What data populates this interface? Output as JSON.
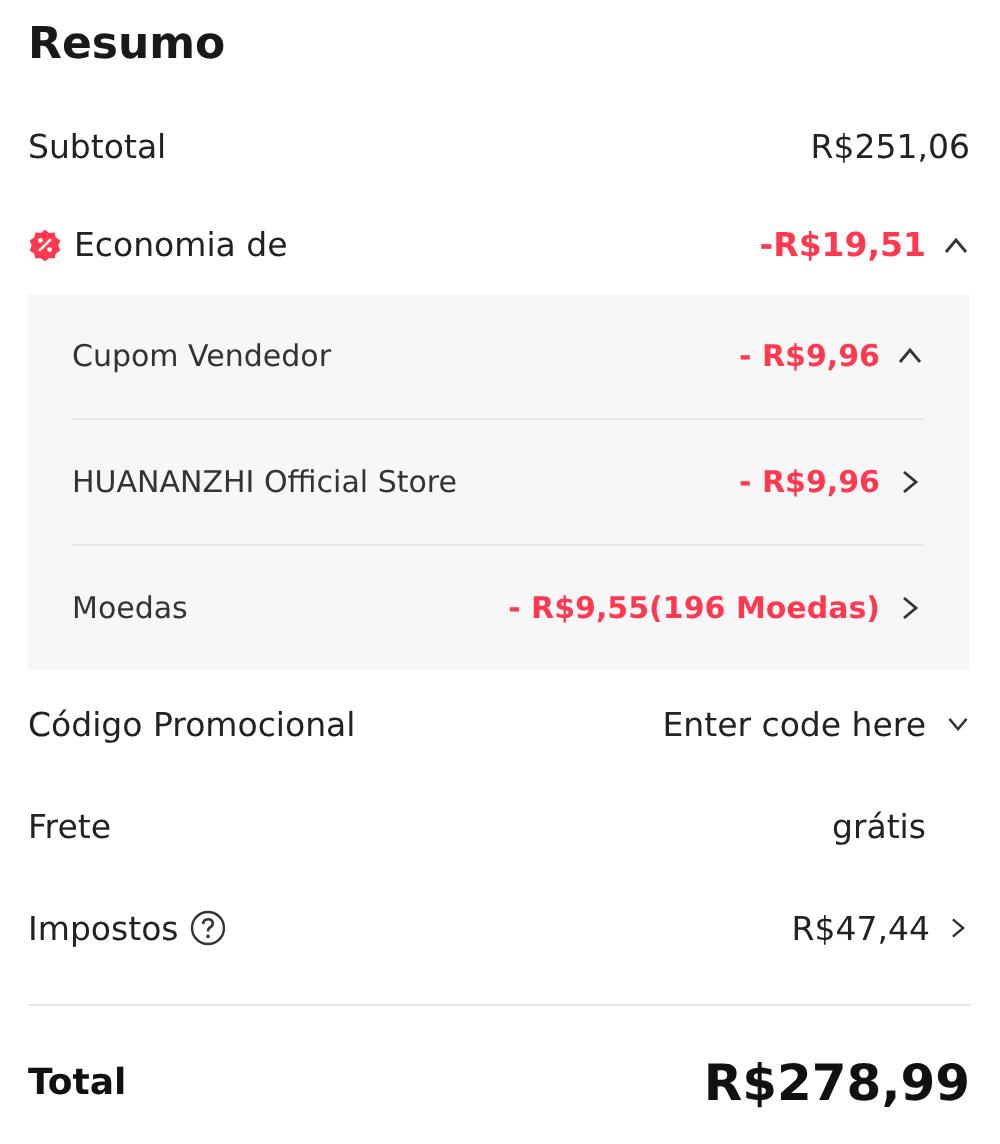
{
  "title": "Resumo",
  "subtotal": {
    "label": "Subtotal",
    "value": "R$251,06"
  },
  "savings": {
    "label": "Economia de",
    "value": "-R$19,51",
    "expanded": true,
    "items": [
      {
        "kind": "toggle",
        "label": "Cupom Vendedor",
        "value": "- R$9,96",
        "expanded": true
      },
      {
        "kind": "link",
        "label": "HUANANZHI Official Store",
        "value": "- R$9,96"
      },
      {
        "kind": "link",
        "label": "Moedas",
        "value": "- R$9,55(196 Moedas)"
      }
    ]
  },
  "promo": {
    "label": "Código Promocional",
    "value": "Enter code here",
    "expanded": false
  },
  "shipping": {
    "label": "Frete",
    "value": "grátis"
  },
  "taxes": {
    "label": "Impostos",
    "value": "R$47,44"
  },
  "total": {
    "label": "Total",
    "value": "R$278,99"
  }
}
